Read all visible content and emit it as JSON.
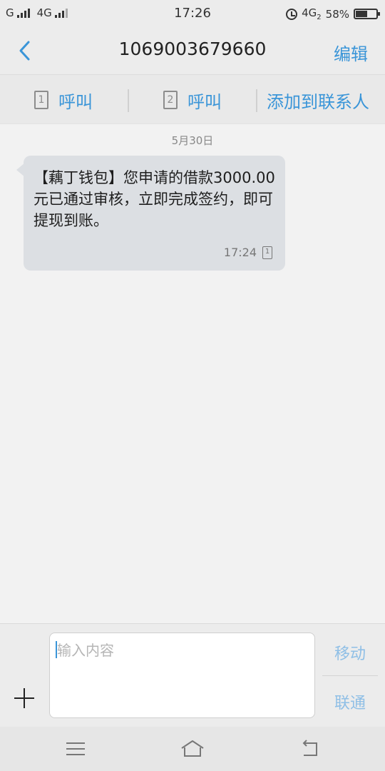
{
  "status_bar": {
    "carrier_1": "G",
    "carrier_2": "4G",
    "time": "17:26",
    "network_right": "4G",
    "network_sub": "2",
    "battery_percent": "58%",
    "battery_level": 0.58
  },
  "header": {
    "title": "1069003679660",
    "edit_label": "编辑"
  },
  "actions": {
    "call_sim1_label": "呼叫",
    "sim1_number": "1",
    "call_sim2_label": "呼叫",
    "sim2_number": "2",
    "add_contact_label": "添加到联系人"
  },
  "conversation": {
    "date": "5月30日",
    "messages": [
      {
        "text": "【藕丁钱包】您申请的借款3000.00元已通过审核，立即完成签约，即可提现到账。",
        "time": "17:24",
        "sim": "1"
      }
    ]
  },
  "compose": {
    "placeholder": "输入内容",
    "send_sim1_label": "移动",
    "send_sim2_label": "联通"
  },
  "colors": {
    "accent": "#3a95d8",
    "bubble": "#dcdfe3",
    "background": "#f2f2f2"
  },
  "icons": {
    "back": "chevron-left-icon",
    "sim": "sim-card-icon",
    "plus": "plus-icon",
    "menu": "menu-icon",
    "home": "home-icon",
    "back_nav": "back-arrow-icon",
    "alarm": "alarm-icon",
    "battery": "battery-icon"
  }
}
